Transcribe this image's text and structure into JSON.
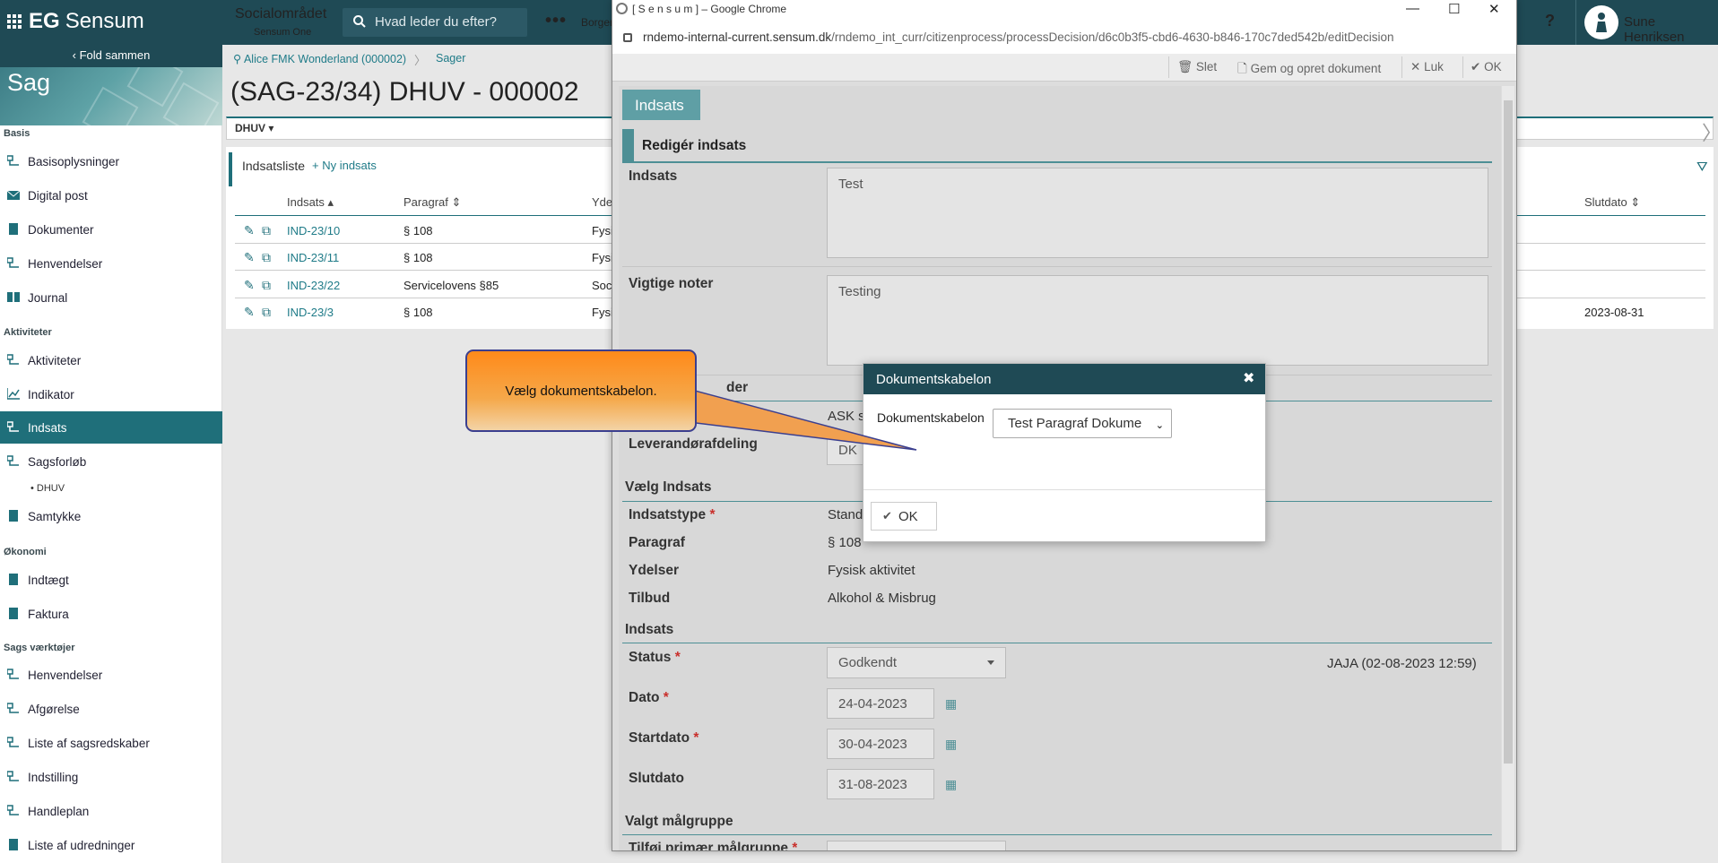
{
  "topbar": {
    "brand_eg": "EG",
    "brand_name": "Sensum",
    "app_name": "Socialområdet",
    "app_sub": "Sensum One",
    "search_placeholder": "Hvad leder du efter?",
    "more": "•••",
    "borger": "Borger",
    "help": "?",
    "user_name": "Sune Henriksen"
  },
  "sidebar": {
    "fold": "Fold sammen",
    "banner": "Sag",
    "sections": {
      "basis": "Basis",
      "aktiviteter": "Aktiviteter",
      "okonomi": "Økonomi",
      "sagsvaerktojer": "Sags værktøjer"
    },
    "items": {
      "basisoplysninger": "Basisoplysninger",
      "digital_post": "Digital post",
      "dokumenter": "Dokumenter",
      "henvendelser": "Henvendelser",
      "journal": "Journal",
      "aktiviteter": "Aktiviteter",
      "indikator": "Indikator",
      "indsats": "Indsats",
      "sagsforlob": "Sagsforløb",
      "dhuv": "• DHUV",
      "samtykke": "Samtykke",
      "indtaegt": "Indtægt",
      "faktura": "Faktura",
      "henvendelser2": "Henvendelser",
      "afgorelse": "Afgørelse",
      "sagsredskaber": "Liste af sagsredskaber",
      "indstilling": "Indstilling",
      "handleplan": "Handleplan",
      "udredninger": "Liste af udredninger"
    }
  },
  "main": {
    "breadcrumb_1": "Alice FMK Wonderland (000002)",
    "breadcrumb_sep": "〉",
    "breadcrumb_2": "Sager",
    "title": "(SAG-23/34) DHUV - 000002",
    "tab": "DHUV ▾",
    "list_title": "Indsatsliste",
    "new_indsats": "+ Ny indsats",
    "columns": {
      "indsats": "Indsats ▴",
      "paragraf": "Paragraf ⇕",
      "ydelse": "Yde",
      "slutdato": "Slutdato ⇕"
    },
    "rows": [
      {
        "id": "IND-23/10",
        "paragraf": "§ 108",
        "ydelse": "Fysi",
        "slutdato": ""
      },
      {
        "id": "IND-23/11",
        "paragraf": "§ 108",
        "ydelse": "Fysi",
        "slutdato": ""
      },
      {
        "id": "IND-23/22",
        "paragraf": "Servicelovens §85",
        "ydelse": "Soci",
        "slutdato": ""
      },
      {
        "id": "IND-23/3",
        "paragraf": "§ 108",
        "ydelse": "Fysi",
        "slutdato": "2023-08-31"
      }
    ]
  },
  "popup": {
    "window_title": "[ S e n s u m ] – Google Chrome",
    "url_host": "rndemo-internal-current.sensum.dk",
    "url_path": "/rndemo_int_curr/citizenprocess/processDecision/d6c0b3f5-cbd6-4630-b846-170c7ded542b/editDecision",
    "toolbar": {
      "slet": "Slet",
      "gem": "Gem og opret dokument",
      "luk": "Luk",
      "ok": "OK"
    },
    "tab": "Indsats",
    "section_header": "Redigér indsats",
    "fields": {
      "indsats_label": "Indsats",
      "indsats_value": "Test",
      "noter_label": "Vigtige noter",
      "noter_value": "Testing",
      "leverandor_partial": "der",
      "ask_value": "ASK s",
      "leverandorafdeling_label": "Leverandørafdeling",
      "leverandorafdeling_value": "DK",
      "vaelg_indsats": "Vælg Indsats",
      "indsatstype_label": "Indsatstype",
      "indsatstype_value": "Stand",
      "paragraf_label": "Paragraf",
      "paragraf_value": "§ 108",
      "ydelser_label": "Ydelser",
      "ydelser_value": "Fysisk aktivitet",
      "tilbud_label": "Tilbud",
      "tilbud_value": "Alkohol & Misbrug",
      "indsats_section": "Indsats",
      "status_label": "Status",
      "status_value": "Godkendt",
      "status_meta": "JAJA (02-08-2023 12:59)",
      "dato_label": "Dato",
      "dato_value": "24-04-2023",
      "startdato_label": "Startdato",
      "startdato_value": "30-04-2023",
      "slutdato_label": "Slutdato",
      "slutdato_value": "31-08-2023",
      "malgruppe_section": "Valgt målgruppe",
      "primaer_label": "Tilføj primær målgruppe",
      "required": "*"
    }
  },
  "modal": {
    "title": "Dokumentskabelon",
    "close": "✖",
    "label": "Dokumentskabelon",
    "selected": "Test Paragraf Dokume",
    "ok": "OK"
  },
  "callout": {
    "text": "Vælg dokumentskabelon."
  }
}
